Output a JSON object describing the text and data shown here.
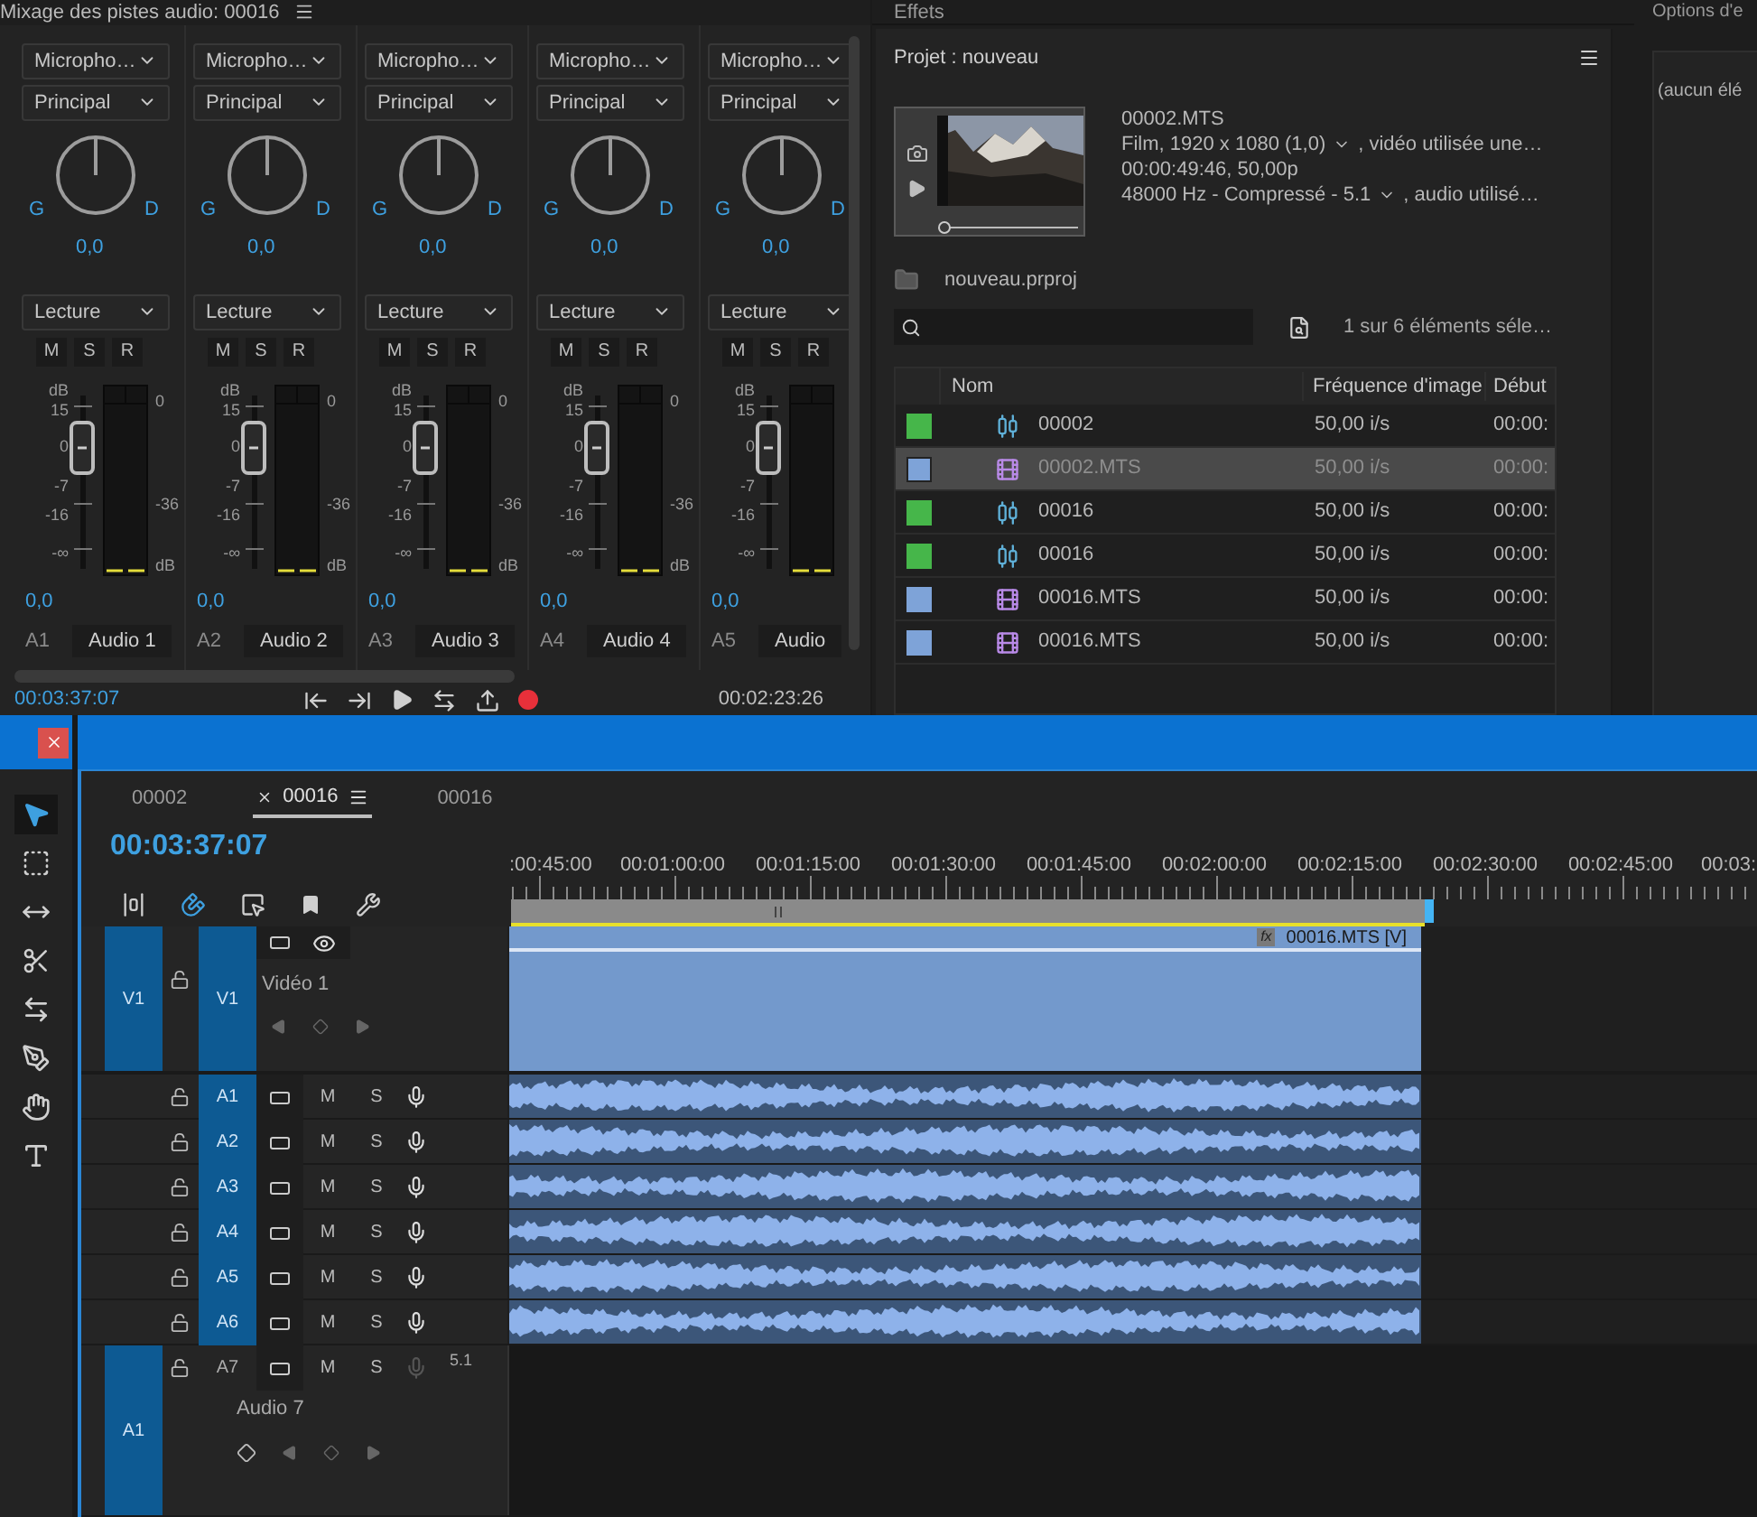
{
  "mixer": {
    "title": "Mixage des pistes audio: 00016",
    "channels": [
      {
        "input": "Micropho…",
        "output": "Principal",
        "pan_left": "G",
        "pan_right": "D",
        "pan_value": "0,0",
        "mode": "Lecture",
        "buttons": [
          "M",
          "S",
          "R"
        ],
        "fader_scale": [
          "dB",
          "15",
          "0",
          "-7",
          "-16",
          "-∞"
        ],
        "meter_scale": [
          "0",
          "-36",
          "dB"
        ],
        "volume": "0,0",
        "track_id": "A1",
        "track_name": "Audio 1"
      },
      {
        "input": "Micropho…",
        "output": "Principal",
        "pan_left": "G",
        "pan_right": "D",
        "pan_value": "0,0",
        "mode": "Lecture",
        "buttons": [
          "M",
          "S",
          "R"
        ],
        "fader_scale": [
          "dB",
          "15",
          "0",
          "-7",
          "-16",
          "-∞"
        ],
        "meter_scale": [
          "0",
          "-36",
          "dB"
        ],
        "volume": "0,0",
        "track_id": "A2",
        "track_name": "Audio 2"
      },
      {
        "input": "Micropho…",
        "output": "Principal",
        "pan_left": "G",
        "pan_right": "D",
        "pan_value": "0,0",
        "mode": "Lecture",
        "buttons": [
          "M",
          "S",
          "R"
        ],
        "fader_scale": [
          "dB",
          "15",
          "0",
          "-7",
          "-16",
          "-∞"
        ],
        "meter_scale": [
          "0",
          "-36",
          "dB"
        ],
        "volume": "0,0",
        "track_id": "A3",
        "track_name": "Audio 3"
      },
      {
        "input": "Micropho…",
        "output": "Principal",
        "pan_left": "G",
        "pan_right": "D",
        "pan_value": "0,0",
        "mode": "Lecture",
        "buttons": [
          "M",
          "S",
          "R"
        ],
        "fader_scale": [
          "dB",
          "15",
          "0",
          "-7",
          "-16",
          "-∞"
        ],
        "meter_scale": [
          "0",
          "-36",
          "dB"
        ],
        "volume": "0,0",
        "track_id": "A4",
        "track_name": "Audio 4"
      },
      {
        "input": "Micropho…",
        "output": "Principal",
        "pan_left": "G",
        "pan_right": "D",
        "pan_value": "0,0",
        "mode": "Lecture",
        "buttons": [
          "M",
          "S",
          "R"
        ],
        "fader_scale": [
          "dB",
          "15",
          "0",
          "-7",
          "-16",
          "-∞"
        ],
        "volume": "0,0",
        "track_id": "A5",
        "track_name": "Audio"
      }
    ],
    "current_time": "00:03:37:07",
    "duration": "00:02:23:26"
  },
  "effects_panel": {
    "title": "Effets"
  },
  "project": {
    "title": "Projet : nouveau",
    "preview": {
      "name": "00002.MTS",
      "video": "Film, 1920 x 1080 (1,0)",
      "video_note": ", vidéo utilisée une…",
      "duration": "00:00:49:46, 50,00p",
      "audio": "48000 Hz - Compressé - 5.1",
      "audio_note": ", audio utilisé…"
    },
    "file": "nouveau.prproj",
    "count": "1 sur 6 éléments séle…",
    "columns": [
      "Nom",
      "Fréquence d'image",
      "Début"
    ],
    "rows": [
      {
        "color": "#46b64a",
        "kind": "sequence",
        "name": "00002",
        "fps": "50,00 i/s",
        "start": "00:00:",
        "selected": false
      },
      {
        "color": "#7ea3d8",
        "kind": "clip",
        "name": "00002.MTS",
        "fps": "50,00 i/s",
        "start": "00:00:",
        "selected": true
      },
      {
        "color": "#46b64a",
        "kind": "sequence",
        "name": "00016",
        "fps": "50,00 i/s",
        "start": "00:00:",
        "selected": false
      },
      {
        "color": "#46b64a",
        "kind": "sequence",
        "name": "00016",
        "fps": "50,00 i/s",
        "start": "00:00:",
        "selected": false
      },
      {
        "color": "#7ea3d8",
        "kind": "clip",
        "name": "00016.MTS",
        "fps": "50,00 i/s",
        "start": "00:00:",
        "selected": false
      },
      {
        "color": "#7ea3d8",
        "kind": "clip",
        "name": "00016.MTS",
        "fps": "50,00 i/s",
        "start": "00:00:",
        "selected": false
      }
    ]
  },
  "options_panel": {
    "title": "Options d'e",
    "content": "(aucun élé"
  },
  "tools": [
    {
      "kind": "select",
      "selected": true
    },
    {
      "kind": "track",
      "selected": false
    },
    {
      "kind": "ripple",
      "selected": false
    },
    {
      "kind": "razor",
      "selected": false
    },
    {
      "kind": "slip",
      "selected": false
    },
    {
      "kind": "pen",
      "selected": false
    },
    {
      "kind": "hand",
      "selected": false
    },
    {
      "kind": "type",
      "selected": false
    }
  ],
  "timeline": {
    "tabs": [
      {
        "label": "00002",
        "selected": false
      },
      {
        "label": "00016",
        "selected": true
      },
      {
        "label": "00016",
        "selected": false
      }
    ],
    "timecode": "00:03:37:07",
    "ruler": [
      ":00:45:00",
      "00:01:00:00",
      "00:01:15:00",
      "00:01:30:00",
      "00:01:45:00",
      "00:02:00:00",
      "00:02:15:00",
      "00:02:30:00",
      "00:02:45:00",
      "00:03:"
    ],
    "video_tracks": [
      {
        "source": "V1",
        "target": "V1",
        "name": "Vidéo 1",
        "clip": {
          "label": "00016.MTS [V]",
          "fx": "fx"
        }
      }
    ],
    "audio_tracks": [
      {
        "target": "A1",
        "targeted": true,
        "buttons": [
          "M",
          "S"
        ],
        "mic_active": true,
        "clip": true
      },
      {
        "target": "A2",
        "targeted": true,
        "buttons": [
          "M",
          "S"
        ],
        "mic_active": true,
        "clip": true
      },
      {
        "target": "A3",
        "targeted": true,
        "buttons": [
          "M",
          "S"
        ],
        "mic_active": true,
        "clip": true
      },
      {
        "target": "A4",
        "targeted": true,
        "buttons": [
          "M",
          "S"
        ],
        "mic_active": true,
        "clip": true
      },
      {
        "target": "A5",
        "targeted": true,
        "buttons": [
          "M",
          "S"
        ],
        "mic_active": true,
        "clip": true
      },
      {
        "target": "A6",
        "targeted": true,
        "buttons": [
          "M",
          "S"
        ],
        "mic_active": true,
        "clip": true
      },
      {
        "source": "A1",
        "target": "A7",
        "targeted": false,
        "buttons": [
          "M",
          "S"
        ],
        "mic_active": false,
        "channels": "5.1",
        "name": "Audio 7",
        "clip": false
      }
    ]
  }
}
